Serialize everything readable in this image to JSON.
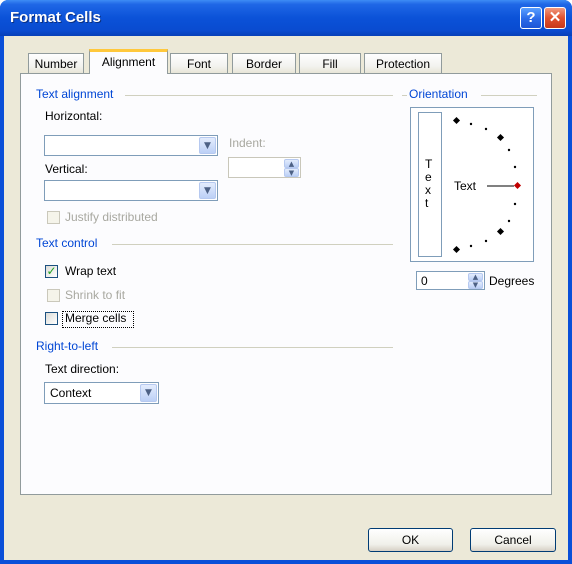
{
  "window": {
    "title": "Format Cells",
    "help_glyph": "?",
    "close_glyph": "✕"
  },
  "tabs": [
    "Number",
    "Alignment",
    "Font",
    "Border",
    "Fill",
    "Protection"
  ],
  "active_tab": "Alignment",
  "text_alignment": {
    "heading": "Text alignment",
    "horizontal_label": "Horizontal:",
    "horizontal_value": "",
    "vertical_label": "Vertical:",
    "vertical_value": "",
    "indent_label": "Indent:",
    "indent_value": "",
    "justify_distributed_label": "Justify distributed"
  },
  "text_control": {
    "heading": "Text control",
    "wrap_text_label": "Wrap text",
    "wrap_text_checked": true,
    "shrink_to_fit_label": "Shrink to fit",
    "merge_cells_label": "Merge cells"
  },
  "right_to_left": {
    "heading": "Right-to-left",
    "text_direction_label": "Text direction:",
    "text_direction_value": "Context"
  },
  "orientation": {
    "heading": "Orientation",
    "vertical_chars": [
      "T",
      "e",
      "x",
      "t"
    ],
    "dial_text": "Text",
    "degrees_value": "0",
    "degrees_label": "Degrees"
  },
  "buttons": {
    "ok": "OK",
    "cancel": "Cancel"
  },
  "colors": {
    "title_bar": "#0a4fd8",
    "group_heading": "#0046d5",
    "active_tab_accent": "#ffc83c",
    "dialog_face": "#ece9d8",
    "check_mark": "#21a121",
    "orientation_marker": "#c00000"
  }
}
